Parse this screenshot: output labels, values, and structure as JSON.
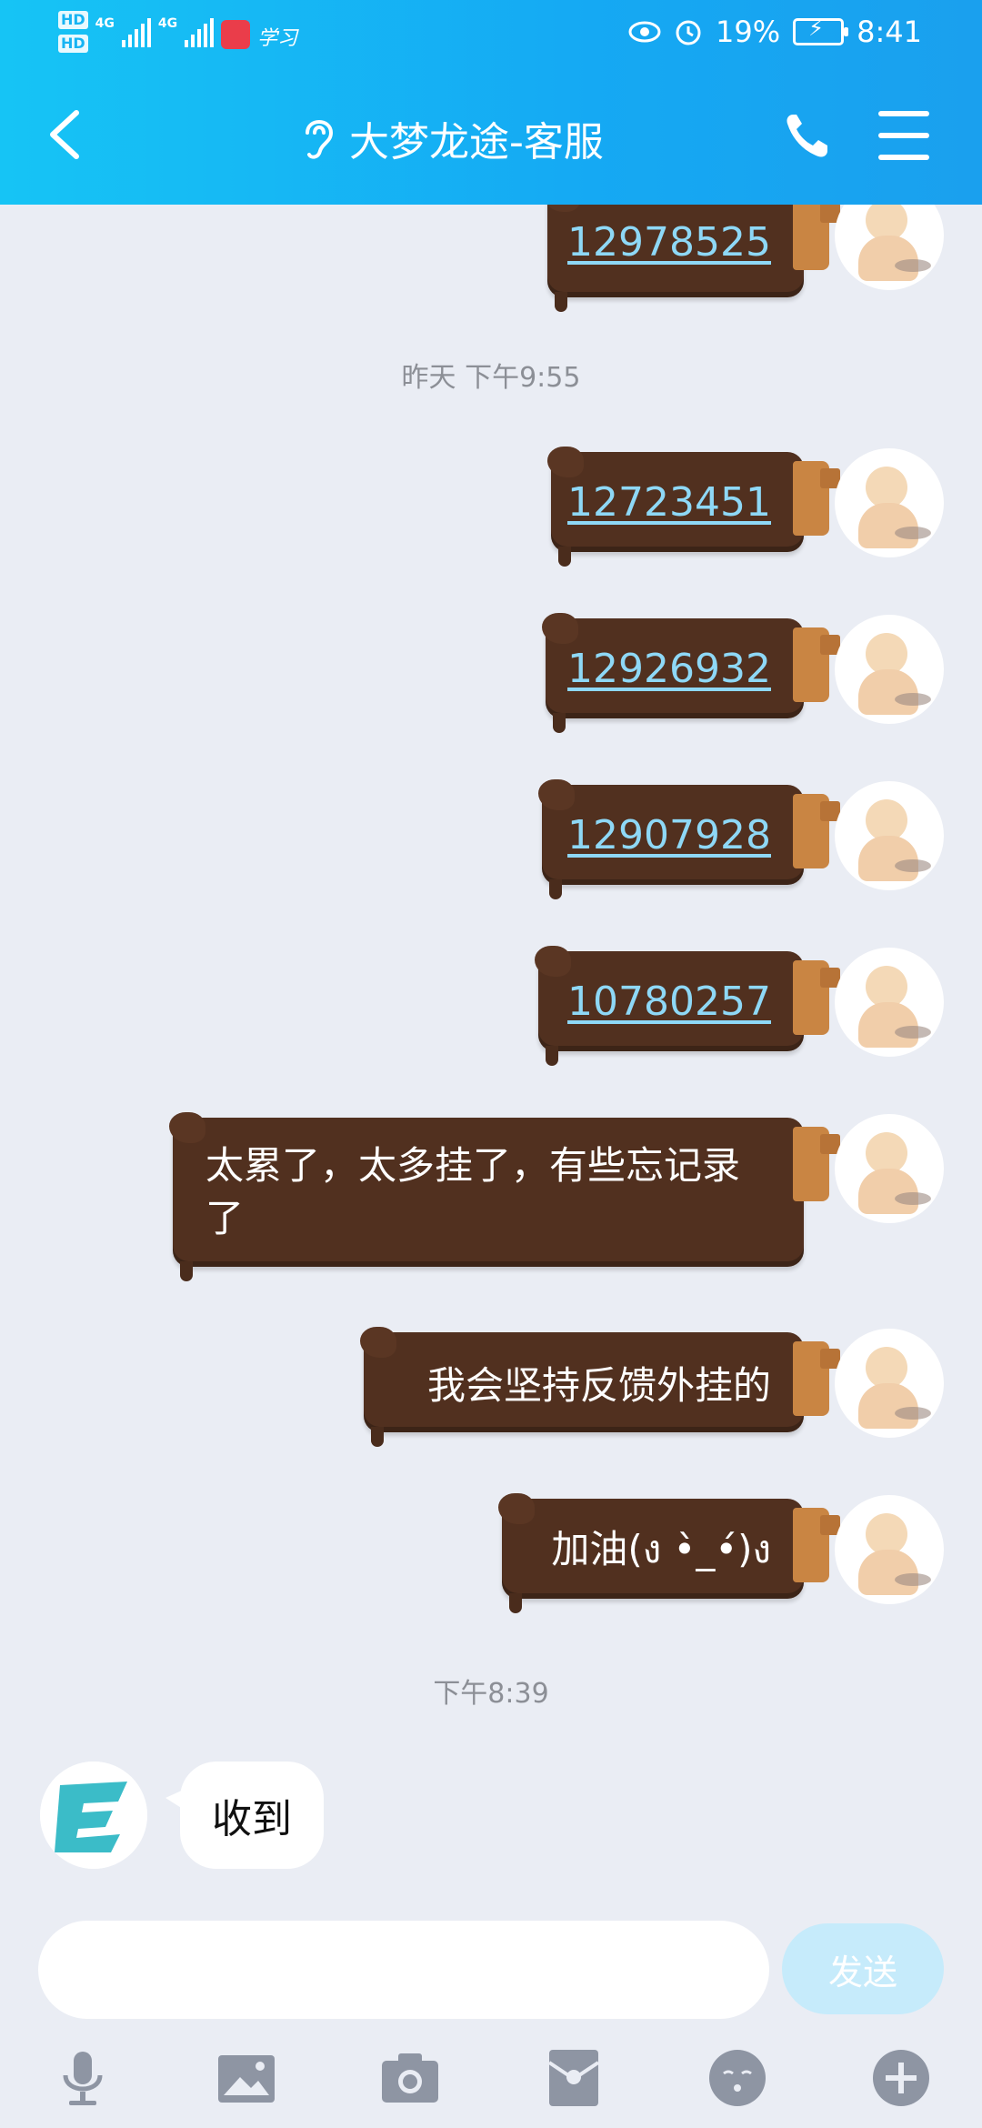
{
  "status_bar": {
    "hd1": "HD",
    "hd2": "HD",
    "network1": "4G",
    "network2": "4G",
    "app_icon2_text": "学习",
    "battery": "19%",
    "time": "8:41"
  },
  "header": {
    "title": "大梦龙途-客服"
  },
  "messages_me": [
    {
      "text": "12978525",
      "link": true
    },
    {
      "text": "12723451",
      "link": true
    },
    {
      "text": "12926932",
      "link": true
    },
    {
      "text": "12907928",
      "link": true
    },
    {
      "text": "10780257",
      "link": true
    },
    {
      "text": "太累了，太多挂了，有些忘记录了",
      "link": false
    },
    {
      "text": "我会坚持反馈外挂的",
      "link": false
    },
    {
      "text": "加油(ง •̀_•́)ง",
      "link": false
    }
  ],
  "timestamps": [
    "昨天 下午9:55",
    "下午8:39"
  ],
  "message_other": {
    "text": "收到"
  },
  "input": {
    "placeholder": "",
    "send_label": "发送"
  },
  "colors": {
    "header": "#16b4f3",
    "bubble_me": "#51301f",
    "link": "#8ed8f6",
    "send_button": "#c6ebfb",
    "background": "#eaedf4"
  },
  "icons": [
    "back-icon",
    "ear-icon",
    "phone-icon",
    "menu-icon",
    "mic-icon",
    "image-icon",
    "camera-icon",
    "red-packet-icon",
    "emoji-icon",
    "plus-icon"
  ]
}
